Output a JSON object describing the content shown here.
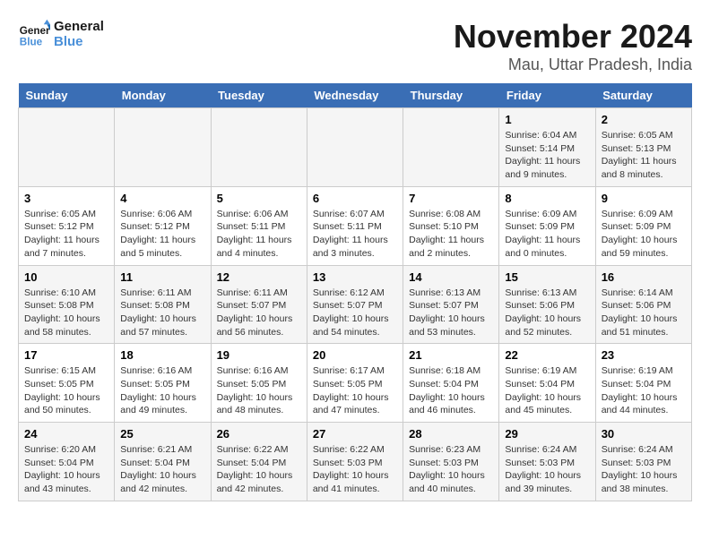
{
  "logo": {
    "line1": "General",
    "line2": "Blue"
  },
  "title": "November 2024",
  "subtitle": "Mau, Uttar Pradesh, India",
  "weekdays": [
    "Sunday",
    "Monday",
    "Tuesday",
    "Wednesday",
    "Thursday",
    "Friday",
    "Saturday"
  ],
  "weeks": [
    [
      {
        "day": "",
        "info": ""
      },
      {
        "day": "",
        "info": ""
      },
      {
        "day": "",
        "info": ""
      },
      {
        "day": "",
        "info": ""
      },
      {
        "day": "",
        "info": ""
      },
      {
        "day": "1",
        "info": "Sunrise: 6:04 AM\nSunset: 5:14 PM\nDaylight: 11 hours and 9 minutes."
      },
      {
        "day": "2",
        "info": "Sunrise: 6:05 AM\nSunset: 5:13 PM\nDaylight: 11 hours and 8 minutes."
      }
    ],
    [
      {
        "day": "3",
        "info": "Sunrise: 6:05 AM\nSunset: 5:12 PM\nDaylight: 11 hours and 7 minutes."
      },
      {
        "day": "4",
        "info": "Sunrise: 6:06 AM\nSunset: 5:12 PM\nDaylight: 11 hours and 5 minutes."
      },
      {
        "day": "5",
        "info": "Sunrise: 6:06 AM\nSunset: 5:11 PM\nDaylight: 11 hours and 4 minutes."
      },
      {
        "day": "6",
        "info": "Sunrise: 6:07 AM\nSunset: 5:11 PM\nDaylight: 11 hours and 3 minutes."
      },
      {
        "day": "7",
        "info": "Sunrise: 6:08 AM\nSunset: 5:10 PM\nDaylight: 11 hours and 2 minutes."
      },
      {
        "day": "8",
        "info": "Sunrise: 6:09 AM\nSunset: 5:09 PM\nDaylight: 11 hours and 0 minutes."
      },
      {
        "day": "9",
        "info": "Sunrise: 6:09 AM\nSunset: 5:09 PM\nDaylight: 10 hours and 59 minutes."
      }
    ],
    [
      {
        "day": "10",
        "info": "Sunrise: 6:10 AM\nSunset: 5:08 PM\nDaylight: 10 hours and 58 minutes."
      },
      {
        "day": "11",
        "info": "Sunrise: 6:11 AM\nSunset: 5:08 PM\nDaylight: 10 hours and 57 minutes."
      },
      {
        "day": "12",
        "info": "Sunrise: 6:11 AM\nSunset: 5:07 PM\nDaylight: 10 hours and 56 minutes."
      },
      {
        "day": "13",
        "info": "Sunrise: 6:12 AM\nSunset: 5:07 PM\nDaylight: 10 hours and 54 minutes."
      },
      {
        "day": "14",
        "info": "Sunrise: 6:13 AM\nSunset: 5:07 PM\nDaylight: 10 hours and 53 minutes."
      },
      {
        "day": "15",
        "info": "Sunrise: 6:13 AM\nSunset: 5:06 PM\nDaylight: 10 hours and 52 minutes."
      },
      {
        "day": "16",
        "info": "Sunrise: 6:14 AM\nSunset: 5:06 PM\nDaylight: 10 hours and 51 minutes."
      }
    ],
    [
      {
        "day": "17",
        "info": "Sunrise: 6:15 AM\nSunset: 5:05 PM\nDaylight: 10 hours and 50 minutes."
      },
      {
        "day": "18",
        "info": "Sunrise: 6:16 AM\nSunset: 5:05 PM\nDaylight: 10 hours and 49 minutes."
      },
      {
        "day": "19",
        "info": "Sunrise: 6:16 AM\nSunset: 5:05 PM\nDaylight: 10 hours and 48 minutes."
      },
      {
        "day": "20",
        "info": "Sunrise: 6:17 AM\nSunset: 5:05 PM\nDaylight: 10 hours and 47 minutes."
      },
      {
        "day": "21",
        "info": "Sunrise: 6:18 AM\nSunset: 5:04 PM\nDaylight: 10 hours and 46 minutes."
      },
      {
        "day": "22",
        "info": "Sunrise: 6:19 AM\nSunset: 5:04 PM\nDaylight: 10 hours and 45 minutes."
      },
      {
        "day": "23",
        "info": "Sunrise: 6:19 AM\nSunset: 5:04 PM\nDaylight: 10 hours and 44 minutes."
      }
    ],
    [
      {
        "day": "24",
        "info": "Sunrise: 6:20 AM\nSunset: 5:04 PM\nDaylight: 10 hours and 43 minutes."
      },
      {
        "day": "25",
        "info": "Sunrise: 6:21 AM\nSunset: 5:04 PM\nDaylight: 10 hours and 42 minutes."
      },
      {
        "day": "26",
        "info": "Sunrise: 6:22 AM\nSunset: 5:04 PM\nDaylight: 10 hours and 42 minutes."
      },
      {
        "day": "27",
        "info": "Sunrise: 6:22 AM\nSunset: 5:03 PM\nDaylight: 10 hours and 41 minutes."
      },
      {
        "day": "28",
        "info": "Sunrise: 6:23 AM\nSunset: 5:03 PM\nDaylight: 10 hours and 40 minutes."
      },
      {
        "day": "29",
        "info": "Sunrise: 6:24 AM\nSunset: 5:03 PM\nDaylight: 10 hours and 39 minutes."
      },
      {
        "day": "30",
        "info": "Sunrise: 6:24 AM\nSunset: 5:03 PM\nDaylight: 10 hours and 38 minutes."
      }
    ]
  ]
}
